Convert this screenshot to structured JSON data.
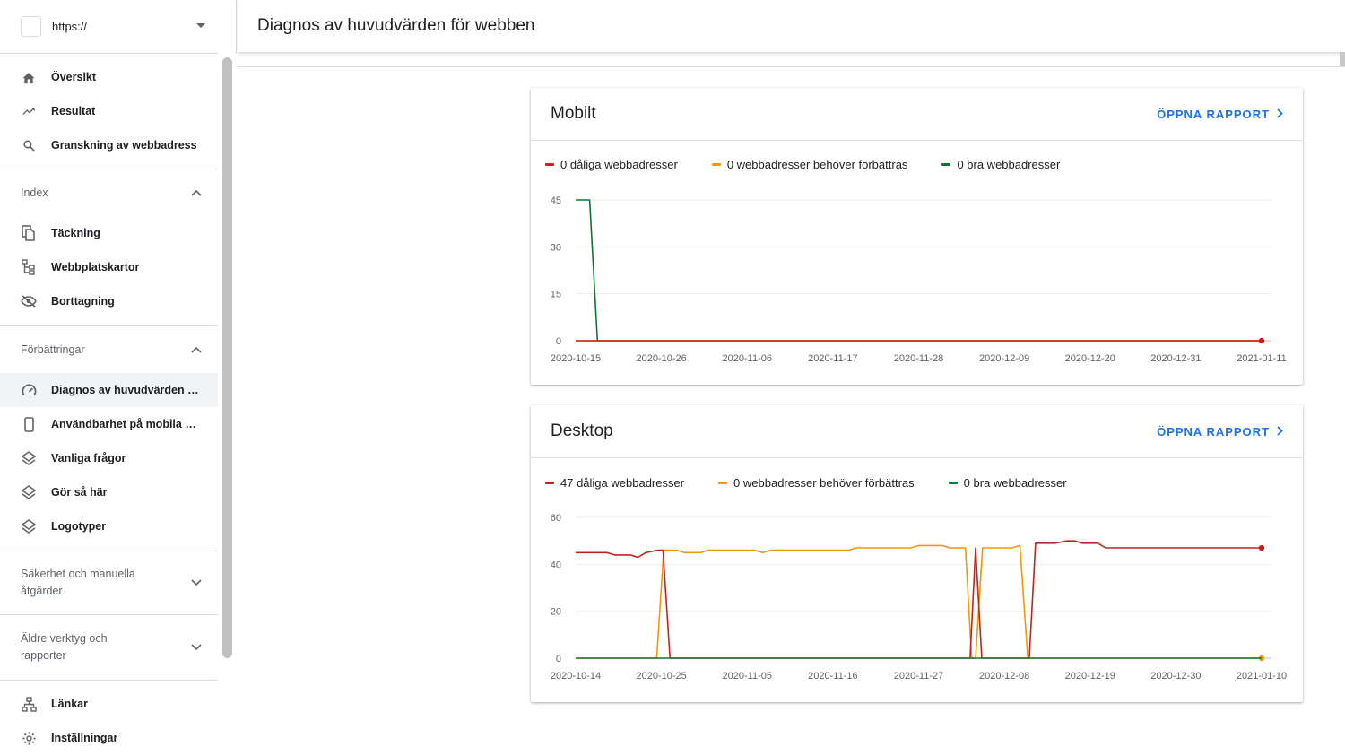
{
  "property": {
    "url": "https://"
  },
  "nav": {
    "top": [
      {
        "label": "Översikt",
        "icon": "home-icon"
      },
      {
        "label": "Resultat",
        "icon": "trending-up-icon"
      },
      {
        "label": "Granskning av webbadress",
        "icon": "search-icon"
      }
    ],
    "index_label": "Index",
    "index": [
      {
        "label": "Täckning",
        "icon": "copy-icon"
      },
      {
        "label": "Webbplatskartor",
        "icon": "sitemap-icon"
      },
      {
        "label": "Borttagning",
        "icon": "visibility-off-icon"
      }
    ],
    "enh_label": "Förbättringar",
    "enh": [
      {
        "label": "Diagnos av huvudvärden fö...",
        "icon": "speed-icon"
      },
      {
        "label": "Användbarhet på mobila en...",
        "icon": "smartphone-icon"
      },
      {
        "label": "Vanliga frågor",
        "icon": "layers-icon"
      },
      {
        "label": "Gör så här",
        "icon": "layers-icon"
      },
      {
        "label": "Logotyper",
        "icon": "layers-icon"
      }
    ],
    "security_label_1": "Säkerhet och manuella",
    "security_label_2": "åtgärder",
    "legacy_label_1": "Äldre verktyg och",
    "legacy_label_2": "rapporter",
    "bottom": [
      {
        "label": "Länkar",
        "icon": "links-icon"
      },
      {
        "label": "Inställningar",
        "icon": "settings-icon"
      }
    ]
  },
  "header": {
    "title": "Diagnos av huvudvärden för webben"
  },
  "colors": {
    "poor": "#c5221f",
    "improve": "#f29900",
    "good": "#137333",
    "accent": "#1a73e8"
  },
  "cards": [
    {
      "title": "Mobilt",
      "open_label": "ÖPPNA RAPPORT",
      "legend": [
        "0 dåliga webbadresser",
        "0 webbadresser behöver förbättras",
        "0 bra webbadresser"
      ]
    },
    {
      "title": "Desktop",
      "open_label": "ÖPPNA RAPPORT",
      "legend": [
        "47 dåliga webbadresser",
        "0 webbadresser behöver förbättras",
        "0 bra webbadresser"
      ]
    }
  ],
  "chart_data": [
    {
      "type": "line",
      "yticks": [
        0,
        15,
        30,
        45
      ],
      "ylim": [
        0,
        45
      ],
      "xlabels": [
        "2020-10-15",
        "2020-10-26",
        "2020-11-06",
        "2020-11-17",
        "2020-11-28",
        "2020-12-09",
        "2020-12-20",
        "2020-12-31",
        "2021-01-11"
      ],
      "xlim": [
        0,
        88
      ],
      "grid": true,
      "series": [
        {
          "key": "good",
          "points": [
            [
              0,
              45
            ],
            [
              1.8,
              45
            ],
            [
              2.8,
              0
            ],
            [
              88,
              0
            ]
          ]
        },
        {
          "key": "improve",
          "points": [
            [
              0,
              0
            ],
            [
              88,
              0
            ]
          ]
        },
        {
          "key": "poor",
          "points": [
            [
              0,
              0
            ],
            [
              88,
              0
            ]
          ],
          "end_dot": true
        }
      ]
    },
    {
      "type": "line",
      "yticks": [
        0,
        20,
        40,
        60
      ],
      "ylim": [
        0,
        60
      ],
      "xlabels": [
        "2020-10-14",
        "2020-10-25",
        "2020-11-05",
        "2020-11-16",
        "2020-11-27",
        "2020-12-08",
        "2020-12-19",
        "2020-12-30",
        "2021-01-10"
      ],
      "xlim": [
        0,
        88
      ],
      "grid": true,
      "series": [
        {
          "key": "improve",
          "points": [
            [
              0,
              0
            ],
            [
              10.4,
              0
            ],
            [
              11.3,
              46
            ],
            [
              13,
              46
            ],
            [
              14,
              45
            ],
            [
              16,
              45
            ],
            [
              17,
              46
            ],
            [
              23,
              46
            ],
            [
              24,
              45
            ],
            [
              25,
              46
            ],
            [
              35,
              46
            ],
            [
              36,
              47
            ],
            [
              43,
              47
            ],
            [
              44,
              48
            ],
            [
              47,
              48
            ],
            [
              48,
              47
            ],
            [
              50,
              47
            ],
            [
              50.8,
              0
            ],
            [
              51.3,
              0
            ],
            [
              52.2,
              47
            ],
            [
              56,
              47
            ],
            [
              57,
              48
            ],
            [
              58,
              0
            ],
            [
              88,
              0
            ]
          ],
          "end_dot": true
        },
        {
          "key": "poor",
          "points": [
            [
              0,
              45
            ],
            [
              4,
              45
            ],
            [
              5,
              44
            ],
            [
              7,
              44
            ],
            [
              8,
              43
            ],
            [
              9,
              45
            ],
            [
              10.5,
              46
            ],
            [
              11.2,
              46
            ],
            [
              12.1,
              0
            ],
            [
              50.6,
              0
            ],
            [
              51.3,
              47
            ],
            [
              52.1,
              0
            ],
            [
              58.2,
              0
            ],
            [
              59,
              49
            ],
            [
              61.5,
              49
            ],
            [
              63,
              50
            ],
            [
              64,
              50
            ],
            [
              65,
              49
            ],
            [
              67,
              49
            ],
            [
              68,
              47
            ],
            [
              88,
              47
            ]
          ],
          "end_dot": true
        },
        {
          "key": "good",
          "points": [
            [
              0,
              0
            ],
            [
              88,
              0
            ]
          ]
        }
      ]
    }
  ]
}
